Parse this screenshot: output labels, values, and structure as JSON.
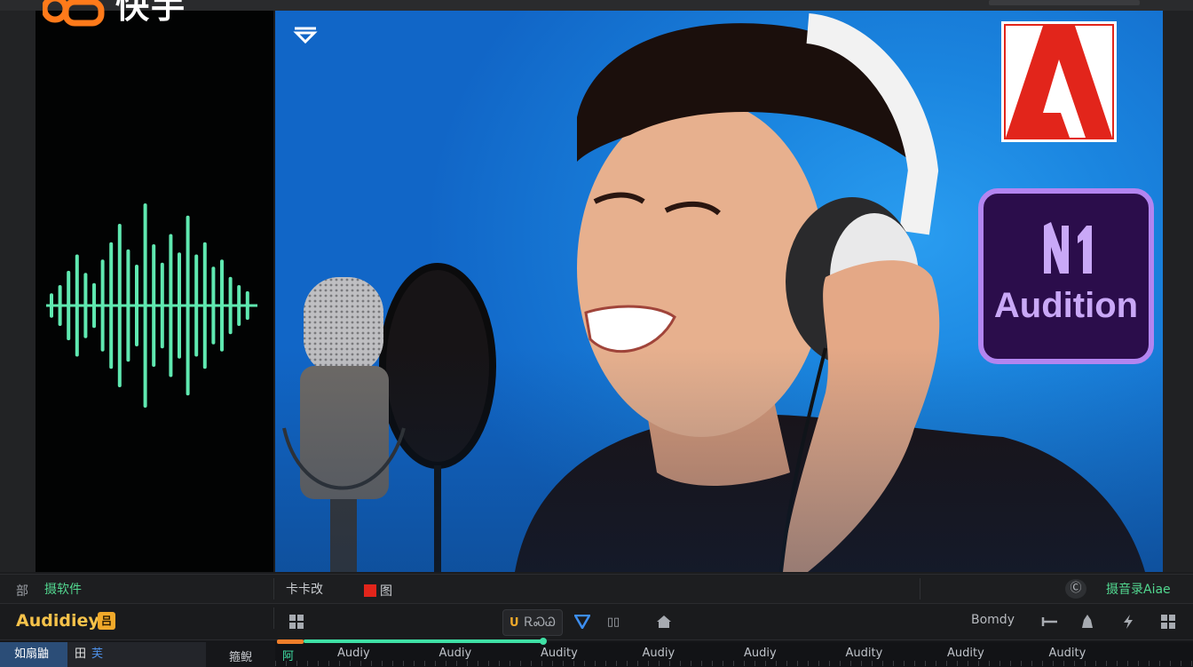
{
  "brand": {
    "name": "快手"
  },
  "preview": {
    "adobe_logo": "adobe-logo",
    "audition_logo_text": "Audition",
    "colors": {
      "background": "#1b86e0",
      "waveform": "#5fe8b0",
      "adobe_red": "#e2251b",
      "audition_purple": "#2b0d4b"
    }
  },
  "waveform": {
    "bar_levels": [
      0.12,
      0.2,
      0.34,
      0.5,
      0.32,
      0.22,
      0.45,
      0.62,
      0.8,
      0.55,
      0.4,
      1.0,
      0.6,
      0.42,
      0.7,
      0.52,
      0.88,
      0.5,
      0.62,
      0.38,
      0.45,
      0.28,
      0.2,
      0.14
    ]
  },
  "status": {
    "left_label": "摄软件",
    "left_icon_text": "部",
    "mid_label": "卡卡改",
    "mid_flag_text": "图",
    "right_label": "摄音录Aiae",
    "right_icon_text": "Ⓒ"
  },
  "toolbar": {
    "app_label": "Audidiey",
    "app_badge": "吕",
    "play_group_label": "ᎡᏍᏊ",
    "play_group_icon": "U",
    "cc_label": "▯▯",
    "ready_label": "Bomdy"
  },
  "timeline": {
    "tab_a": "如扇鼬",
    "tab_b_icon": "田",
    "tab_b_label": "芙",
    "label": "箍鲵",
    "start_label": "阿",
    "clips": [
      "Audiy",
      "Audiy",
      "Audity",
      "Audiy",
      "Audiy",
      "Audity",
      "Audity",
      "Audity"
    ],
    "progress": 0.3
  }
}
